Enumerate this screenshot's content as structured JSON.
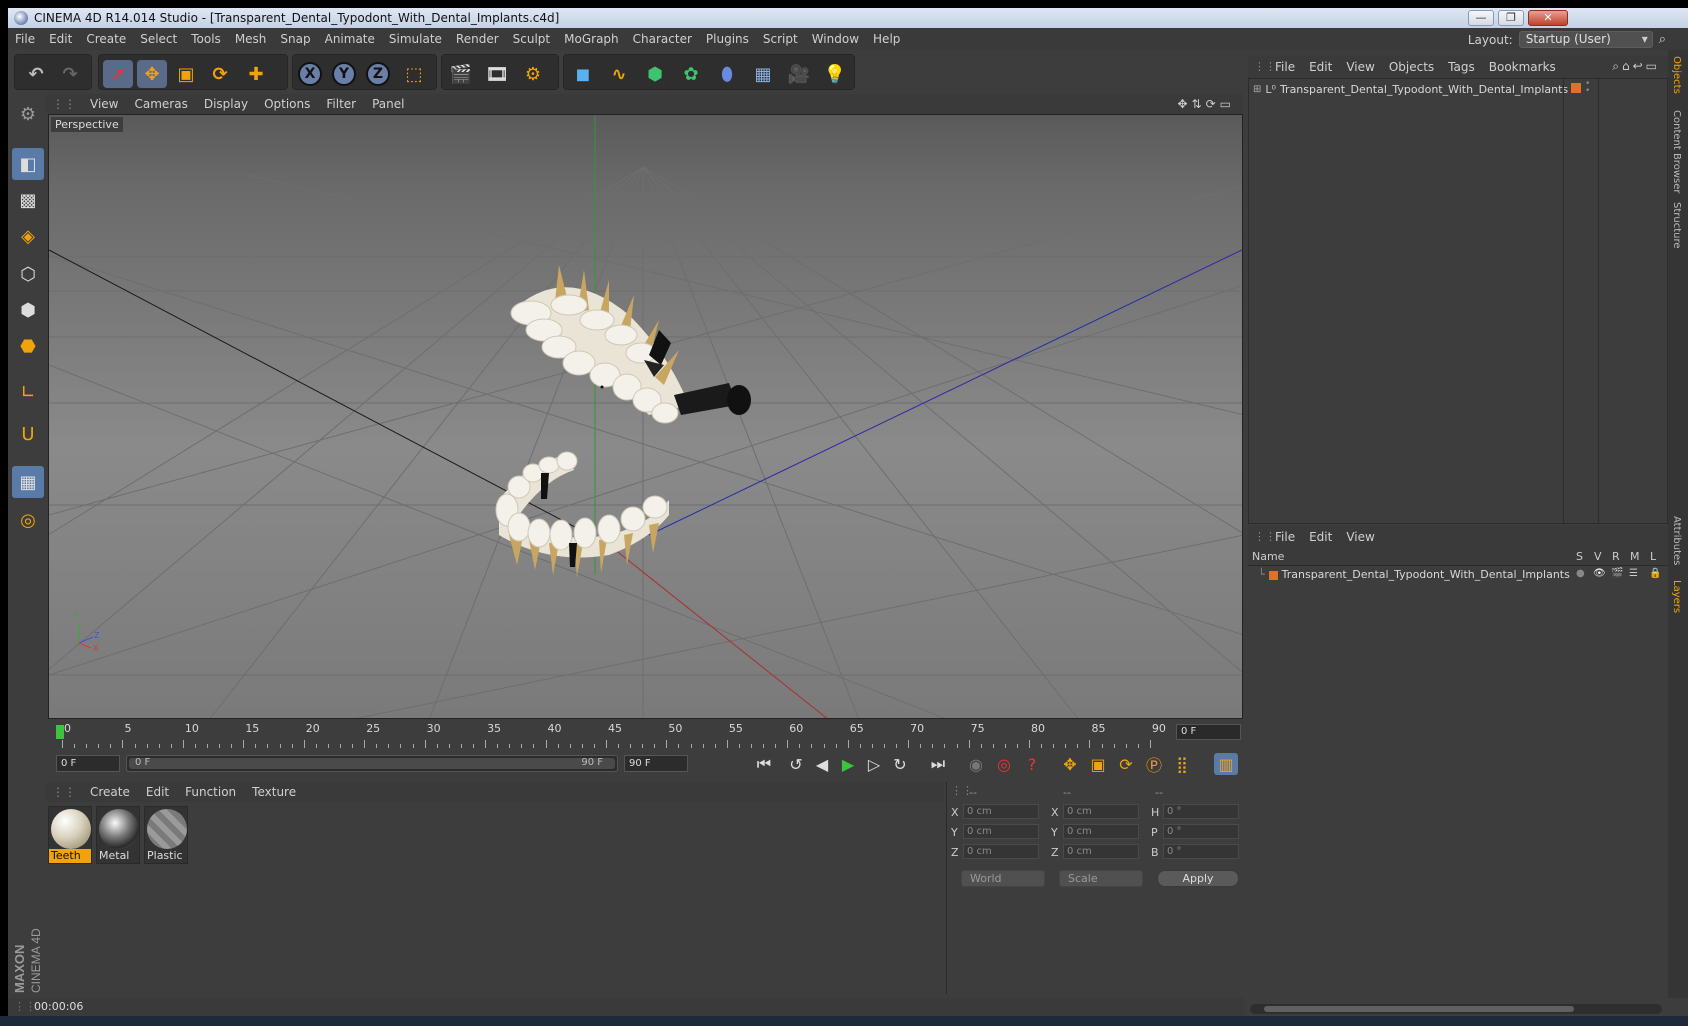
{
  "window": {
    "title": "CINEMA 4D R14.014 Studio - [Transparent_Dental_Typodont_With_Dental_Implants.c4d]",
    "controls": [
      "—",
      "❐",
      "✕"
    ]
  },
  "menubar": {
    "items": [
      "File",
      "Edit",
      "Create",
      "Select",
      "Tools",
      "Mesh",
      "Snap",
      "Animate",
      "Simulate",
      "Render",
      "Sculpt",
      "MoGraph",
      "Character",
      "Plugins",
      "Script",
      "Window",
      "Help"
    ],
    "layout_label": "Layout:",
    "layout_value": "Startup (User)"
  },
  "toolbar": {
    "axes": [
      "X",
      "Y",
      "Z"
    ]
  },
  "viewport": {
    "menu": [
      "View",
      "Cameras",
      "Display",
      "Options",
      "Filter",
      "Panel"
    ],
    "label": "Perspective",
    "axis_labels": [
      "Y",
      "Z",
      "X"
    ]
  },
  "timeline": {
    "ticks": [
      "0",
      "5",
      "10",
      "15",
      "20",
      "25",
      "30",
      "35",
      "40",
      "45",
      "50",
      "55",
      "60",
      "65",
      "70",
      "75",
      "80",
      "85",
      "90"
    ],
    "current_frame": "0 F"
  },
  "transport": {
    "start_field": "0 F",
    "range_start": "0 F",
    "range_end": "90 F",
    "end_field": "90 F"
  },
  "materials": {
    "menu": [
      "Create",
      "Edit",
      "Function",
      "Texture"
    ],
    "items": [
      {
        "name": "Teeth",
        "selected": true
      },
      {
        "name": "Metal",
        "selected": false
      },
      {
        "name": "Plastic",
        "selected": false
      }
    ]
  },
  "coordinates": {
    "headers": [
      "--",
      "--",
      "--"
    ],
    "rows": [
      {
        "l1": "X",
        "v1": "0 cm",
        "l2": "X",
        "v2": "0 cm",
        "l3": "H",
        "v3": "0 °"
      },
      {
        "l1": "Y",
        "v1": "0 cm",
        "l2": "Y",
        "v2": "0 cm",
        "l3": "P",
        "v3": "0 °"
      },
      {
        "l1": "Z",
        "v1": "0 cm",
        "l2": "Z",
        "v2": "0 cm",
        "l3": "B",
        "v3": "0 °"
      }
    ],
    "space": "World",
    "mode": "Scale",
    "apply": "Apply"
  },
  "status": {
    "time": "00:00:06"
  },
  "objects_panel": {
    "menu": [
      "File",
      "Edit",
      "View",
      "Objects",
      "Tags",
      "Bookmarks"
    ],
    "object_name": "Transparent_Dental_Typodont_With_Dental_Implants"
  },
  "layers_panel": {
    "menu": [
      "File",
      "Edit",
      "View"
    ],
    "columns": [
      "Name",
      "S",
      "V",
      "R",
      "M",
      "L"
    ],
    "layer_name": "Transparent_Dental_Typodont_With_Dental_Implants"
  },
  "side_tabs": [
    "Objects",
    "Content Browser",
    "Structure",
    "Attributes",
    "Layers"
  ],
  "logo": {
    "brand": "MAXON",
    "product": "CINEMA 4D"
  },
  "colors": {
    "accent": "#f0a30a",
    "playhead": "#3ec33e",
    "selected_tool": "#5a7aa8"
  }
}
